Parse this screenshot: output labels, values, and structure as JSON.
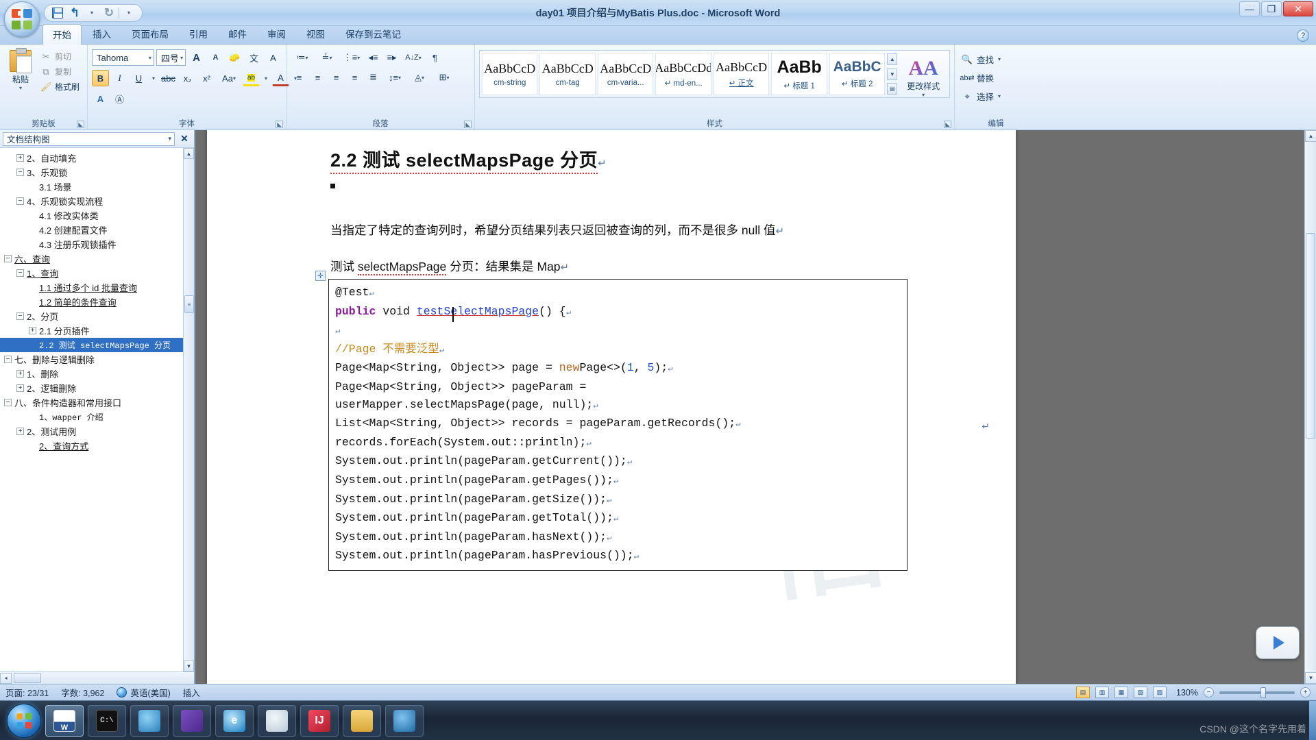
{
  "window": {
    "title": "day01 项目介绍与MyBatis Plus.doc - Microsoft Word",
    "minimize": "—",
    "maximize": "❐",
    "close": "✕"
  },
  "quick_access": {
    "save": "save-icon",
    "undo": "↰",
    "undo_caret": "▾",
    "redo": "↻",
    "customize": "▾"
  },
  "tabs": [
    {
      "label": "开始",
      "active": true
    },
    {
      "label": "插入",
      "active": false
    },
    {
      "label": "页面布局",
      "active": false
    },
    {
      "label": "引用",
      "active": false
    },
    {
      "label": "邮件",
      "active": false
    },
    {
      "label": "审阅",
      "active": false
    },
    {
      "label": "视图",
      "active": false
    },
    {
      "label": "保存到云笔记",
      "active": false
    }
  ],
  "help_icon": "?",
  "ribbon": {
    "clipboard": {
      "label": "剪贴板",
      "paste": "粘贴",
      "cut": "剪切",
      "copy": "复制",
      "format_painter": "格式刷",
      "caret": "▾"
    },
    "font": {
      "label": "字体",
      "font_name": "Tahoma",
      "font_size": "四号",
      "grow_font": "A",
      "shrink_font": "A",
      "clear_format": "Aa",
      "phonetic": "文",
      "char_border": "A",
      "bold": "B",
      "italic": "I",
      "underline": "U",
      "strikethrough": "abc",
      "subscript": "x₂",
      "superscript": "x²",
      "change_case": "Aa",
      "highlight": "ab",
      "font_color": "A",
      "text_effect": "A",
      "enclose_char": "字",
      "caret": "▾"
    },
    "paragraph": {
      "label": "段落",
      "bullets": "≔",
      "numbering": "≟",
      "multilevel": "⋮≡",
      "decrease_indent": "◂≡",
      "increase_indent": "≡▸",
      "sort": "A↓Z",
      "show_marks": "¶",
      "align_left": "≡",
      "align_center": "≡",
      "align_right": "≡",
      "justify": "≡",
      "distribute": "≣",
      "line_spacing": "↕≡",
      "shading": "◬",
      "borders": "⊞",
      "caret": "▾"
    },
    "styles": {
      "label": "样式",
      "sample": "AaBbCcD",
      "items": [
        {
          "name": "cm-string",
          "sample": "AaBbCcD",
          "kind": "plain"
        },
        {
          "name": "cm-tag",
          "sample": "AaBbCcD",
          "kind": "plain"
        },
        {
          "name": "cm-varia...",
          "sample": "AaBbCcD",
          "kind": "plain"
        },
        {
          "name": "↵ md-en...",
          "sample": "AaBbCcDd",
          "kind": "plain"
        },
        {
          "name": "↵ 正文",
          "sample": "AaBbCcD",
          "kind": "body"
        },
        {
          "name": "↵ 标题 1",
          "sample": "AaBb",
          "kind": "h1"
        },
        {
          "name": "↵ 标题 2",
          "sample": "AaBbC",
          "kind": "h2"
        }
      ],
      "scroll_up": "▲",
      "scroll_down": "▼",
      "more": "▤",
      "change_styles": "更改样式",
      "change_styles_icon": "AA",
      "caret": "▾"
    },
    "editing": {
      "label": "编辑",
      "find": "查找",
      "replace": "替换",
      "select": "选择",
      "find_icon": "find-binoculars-icon",
      "replace_icon": "replace-icon",
      "select_icon": "cursor-arrow-icon",
      "caret": "▾"
    }
  },
  "docmap": {
    "title": "文档结构图",
    "caret": "▾",
    "close": "✕",
    "items": [
      {
        "label": "2、自动填充",
        "indent": 1,
        "expander": "+",
        "mono": false
      },
      {
        "label": "3、乐观锁",
        "indent": 1,
        "expander": "−",
        "mono": false
      },
      {
        "label": "3.1 场景",
        "indent": 2,
        "expander": "",
        "mono": false
      },
      {
        "label": "4、乐观锁实现流程",
        "indent": 1,
        "expander": "−",
        "mono": false
      },
      {
        "label": "4.1 修改实体类",
        "indent": 2,
        "expander": "",
        "mono": false
      },
      {
        "label": "4.2 创建配置文件",
        "indent": 2,
        "expander": "",
        "mono": false
      },
      {
        "label": "4.3 注册乐观锁插件",
        "indent": 2,
        "expander": "",
        "mono": false
      },
      {
        "label": "六、查询",
        "indent": 0,
        "expander": "−",
        "mono": false,
        "underline": true
      },
      {
        "label": "1、查询",
        "indent": 1,
        "expander": "−",
        "mono": false,
        "underline": true
      },
      {
        "label": "1.1 通过多个 id 批量查询",
        "indent": 2,
        "expander": "",
        "mono": false,
        "underline": true
      },
      {
        "label": "1.2 简单的条件查询",
        "indent": 2,
        "expander": "",
        "mono": false,
        "underline": true
      },
      {
        "label": "2、分页",
        "indent": 1,
        "expander": "−",
        "mono": false
      },
      {
        "label": "2.1 分页插件",
        "indent": 2,
        "expander": "+",
        "mono": false
      },
      {
        "label": "2.2 测试 selectMapsPage 分页",
        "indent": 2,
        "expander": "",
        "mono": true,
        "selected": true
      },
      {
        "label": "七、删除与逻辑删除",
        "indent": 0,
        "expander": "−",
        "mono": false
      },
      {
        "label": "1、删除",
        "indent": 1,
        "expander": "+",
        "mono": false
      },
      {
        "label": "2、逻辑删除",
        "indent": 1,
        "expander": "+",
        "mono": false
      },
      {
        "label": "八、条件构造器和常用接口",
        "indent": 0,
        "expander": "−",
        "mono": false
      },
      {
        "label": "1、wapper 介绍",
        "indent": 2,
        "expander": "",
        "mono": true
      },
      {
        "label": "2、测试用例",
        "indent": 1,
        "expander": "+",
        "mono": false
      },
      {
        "label": "2、查询方式",
        "indent": 2,
        "expander": "",
        "mono": false,
        "underline": true
      }
    ],
    "scroll_up": "▲",
    "scroll_down": "▼",
    "left": "◂",
    "right": "▸"
  },
  "document": {
    "heading": "2.2 测试 selectMapsPage 分页",
    "paragraph1": "当指定了特定的查询列时，希望分页结果列表只返回被查询的列，而不是很多 null 值",
    "paragraph2_pre": "测试 ",
    "paragraph2_mid": "selectMapsPage",
    "paragraph2_post": " 分页：结果集是 Map",
    "pilcrow": "↵",
    "move_handle": "✛",
    "watermark": "俗",
    "code_lines": [
      {
        "segments": [
          {
            "t": "@Test",
            "c": "plain"
          },
          {
            "t": "↵",
            "c": "cret"
          }
        ]
      },
      {
        "segments": [
          {
            "t": "public",
            "c": "kw"
          },
          {
            "t": " void ",
            "c": "plain"
          },
          {
            "t": "testSelectMapsPage",
            "c": "fn"
          },
          {
            "t": "() {",
            "c": "plain"
          },
          {
            "t": "↵",
            "c": "cret"
          }
        ]
      },
      {
        "segments": [
          {
            "t": "↵",
            "c": "cret"
          }
        ]
      },
      {
        "segments": [
          {
            "t": "//Page 不需要泛型",
            "c": "cmt"
          },
          {
            "t": "↵",
            "c": "cret"
          }
        ]
      },
      {
        "segments": [
          {
            "t": "Page<Map<String, Object>> page = ",
            "c": "plain"
          },
          {
            "t": "new",
            "c": "nw"
          },
          {
            "t": "Page<>(",
            "c": "plain"
          },
          {
            "t": "1",
            "c": "num"
          },
          {
            "t": ", ",
            "c": "plain"
          },
          {
            "t": "5",
            "c": "num"
          },
          {
            "t": ");",
            "c": "plain"
          },
          {
            "t": "↵",
            "c": "cret"
          }
        ]
      },
      {
        "segments": [
          {
            "t": "Page<Map<String, Object>> pageParam =",
            "c": "plain"
          }
        ]
      },
      {
        "segments": [
          {
            "t": "userMapper.selectMapsPage(page, null);",
            "c": "plain"
          },
          {
            "t": "↵",
            "c": "cret"
          }
        ]
      },
      {
        "segments": [
          {
            "t": "List<Map<String, Object>> records = pageParam.getRecords();",
            "c": "plain"
          },
          {
            "t": "↵",
            "c": "cret"
          }
        ]
      },
      {
        "segments": [
          {
            "t": "records.forEach(System.out::println);",
            "c": "plain"
          },
          {
            "t": "↵",
            "c": "cret"
          }
        ]
      },
      {
        "segments": [
          {
            "t": "System.out.println(pageParam.getCurrent());",
            "c": "plain"
          },
          {
            "t": "↵",
            "c": "cret"
          }
        ]
      },
      {
        "segments": [
          {
            "t": "System.out.println(pageParam.getPages());",
            "c": "plain"
          },
          {
            "t": "↵",
            "c": "cret"
          }
        ]
      },
      {
        "segments": [
          {
            "t": "System.out.println(pageParam.getSize());",
            "c": "plain"
          },
          {
            "t": "↵",
            "c": "cret"
          }
        ]
      },
      {
        "segments": [
          {
            "t": "System.out.println(pageParam.getTotal());",
            "c": "plain"
          },
          {
            "t": "↵",
            "c": "cret"
          }
        ]
      },
      {
        "segments": [
          {
            "t": "System.out.println(pageParam.hasNext());",
            "c": "plain"
          },
          {
            "t": "↵",
            "c": "cret"
          }
        ]
      },
      {
        "segments": [
          {
            "t": "System.out.println(pageParam.hasPrevious());",
            "c": "plain"
          },
          {
            "t": "↵",
            "c": "cret"
          }
        ]
      }
    ]
  },
  "statusbar": {
    "page": "页面: 23/31",
    "words": "字数: 3,962",
    "language": "英语(美国)",
    "insert_mode": "插入",
    "proofing_icon": "proofing-icon",
    "zoom": "130%",
    "zoom_out": "−",
    "zoom_in": "+",
    "views": [
      "print-layout-view",
      "full-screen-view",
      "web-layout-view",
      "outline-view",
      "draft-view"
    ]
  },
  "taskbar": {
    "start": "start-orb",
    "items": [
      {
        "name": "word",
        "label": "W"
      },
      {
        "name": "command-prompt",
        "label": "C:\\"
      },
      {
        "name": "navicat",
        "label": ""
      },
      {
        "name": "visual-studio",
        "label": ""
      },
      {
        "name": "internet-explorer",
        "label": "e"
      },
      {
        "name": "paint",
        "label": ""
      },
      {
        "name": "intellij-idea",
        "label": "IJ"
      },
      {
        "name": "file-explorer",
        "label": ""
      },
      {
        "name": "virtualbox",
        "label": ""
      }
    ],
    "watermark": "CSDN @这个名字先用着"
  }
}
